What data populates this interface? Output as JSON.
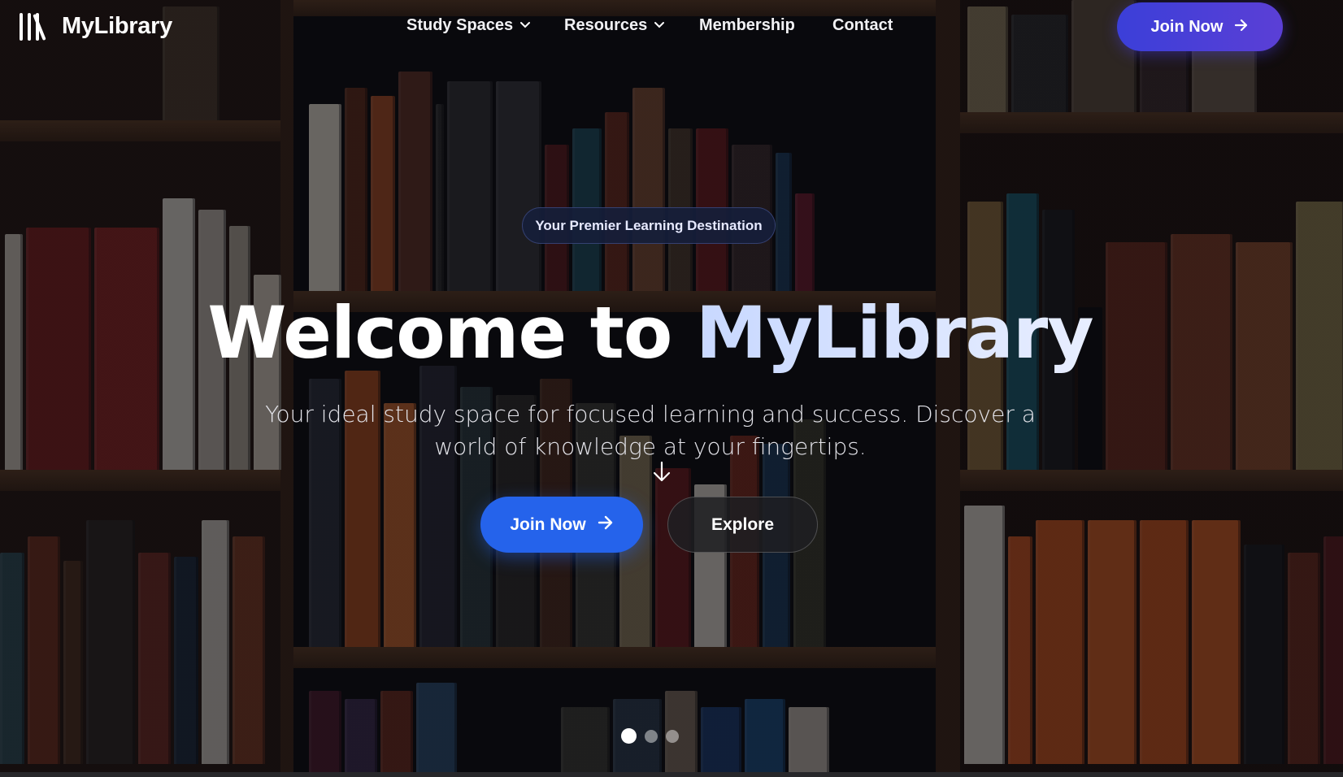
{
  "brand": {
    "name": "MyLibrary",
    "logo_icon": "library-books-icon"
  },
  "nav": {
    "links": [
      {
        "label": "Study Spaces",
        "has_dropdown": true
      },
      {
        "label": "Resources",
        "has_dropdown": true
      },
      {
        "label": "Membership",
        "has_dropdown": false
      },
      {
        "label": "Contact",
        "has_dropdown": false
      }
    ],
    "cta_label": "Join Now",
    "dropdown_icon": "chevron-down-icon",
    "arrow_icon": "arrow-right-icon"
  },
  "hero": {
    "badge": "Your Premier Learning Destination",
    "title_part1": "Welcome to",
    "title_part2": "MyLibrary",
    "subtitle": "Your ideal study space for focused learning and success. Discover a world of knowledge at your fingertips.",
    "primary_button": "Join Now",
    "secondary_button": "Explore",
    "scroll_icon": "arrow-down-icon",
    "slides": {
      "count": 3,
      "active": 1
    }
  },
  "colors": {
    "accent_blue": "#2563eb",
    "nav_cta_start": "#3b3fd8",
    "nav_cta_end": "#5b3fd6",
    "badge_bg": "#161e3a"
  }
}
